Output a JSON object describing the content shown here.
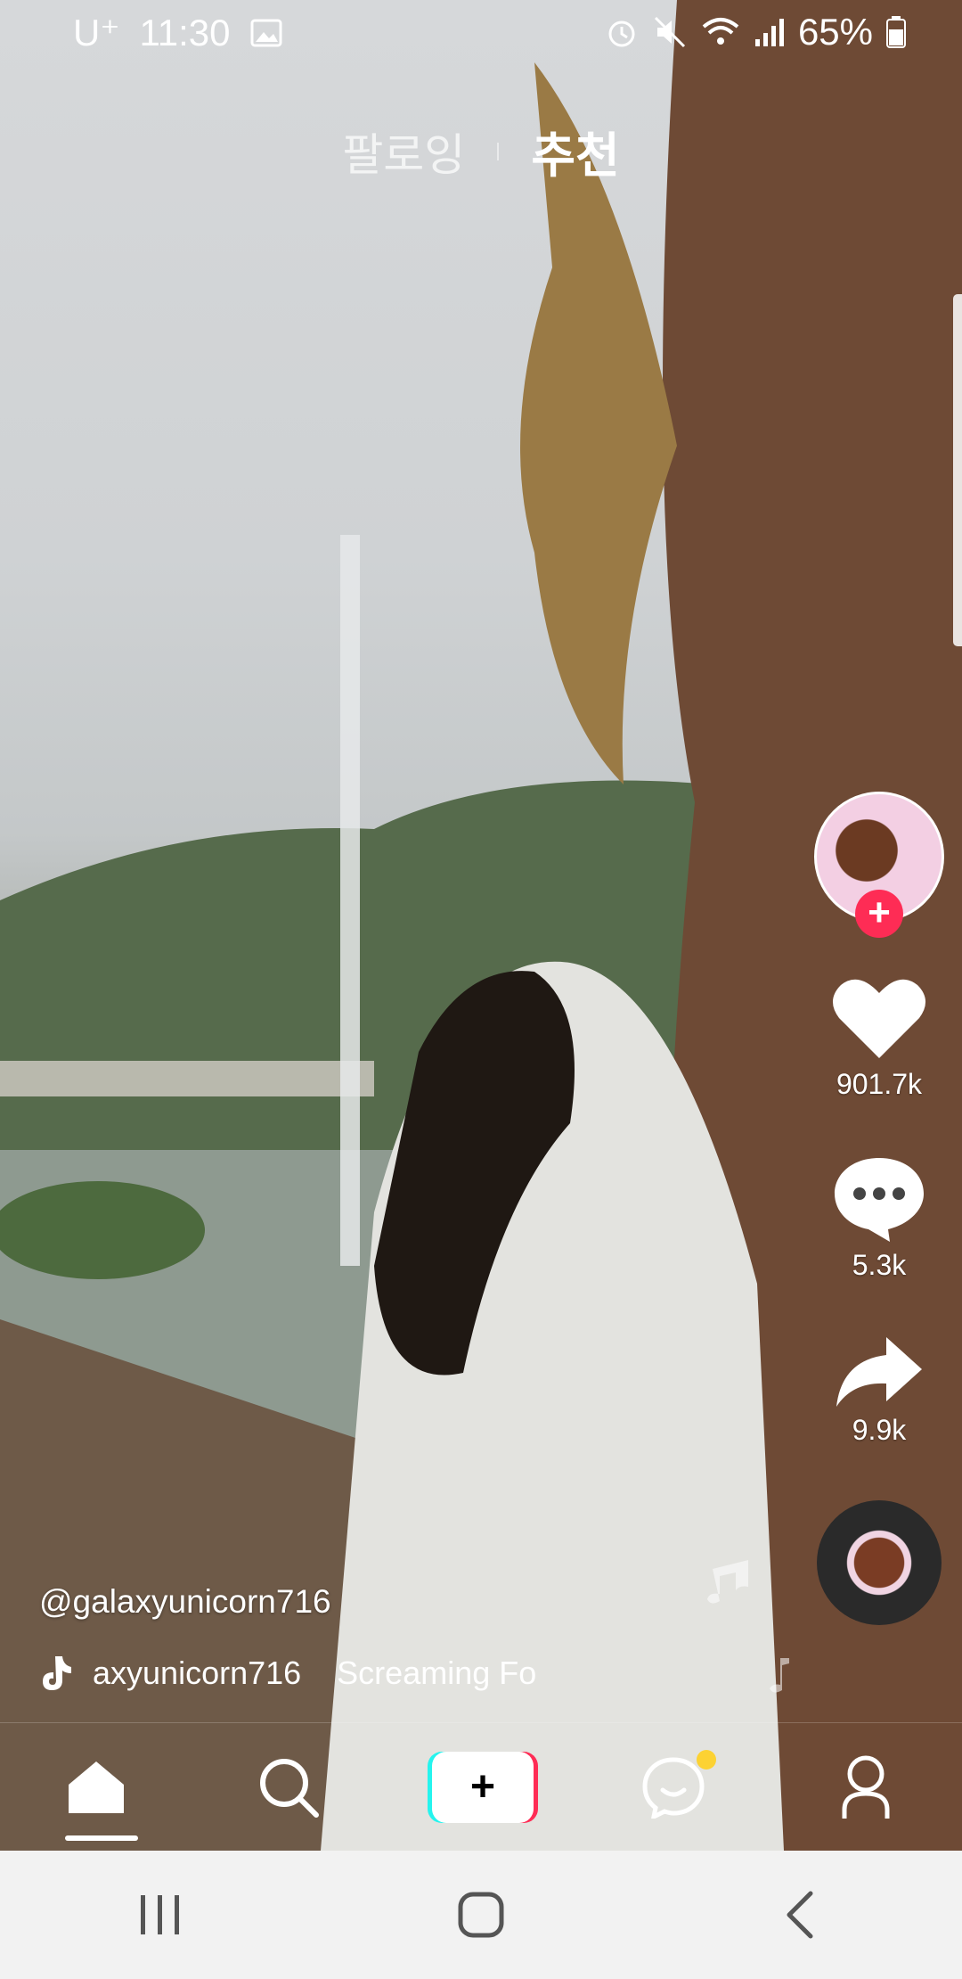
{
  "status_bar": {
    "carrier": "U⁺",
    "time": "11:30",
    "battery": "65%"
  },
  "top_tabs": {
    "following": "팔로잉",
    "recommended": "추천"
  },
  "side_actions": {
    "likes": "901.7k",
    "comments": "5.3k",
    "shares": "9.9k"
  },
  "caption": {
    "username": "@galaxyunicorn716"
  },
  "sound": {
    "owner": "axyunicorn716",
    "title": "Screaming Fo"
  },
  "bottom_nav": {
    "items": [
      "home",
      "discover",
      "create",
      "inbox",
      "profile"
    ],
    "create_symbol": "+"
  },
  "colors": {
    "accent_red": "#fe2c55",
    "accent_cyan": "#25f4ee",
    "notification_dot": "#fcd233"
  }
}
